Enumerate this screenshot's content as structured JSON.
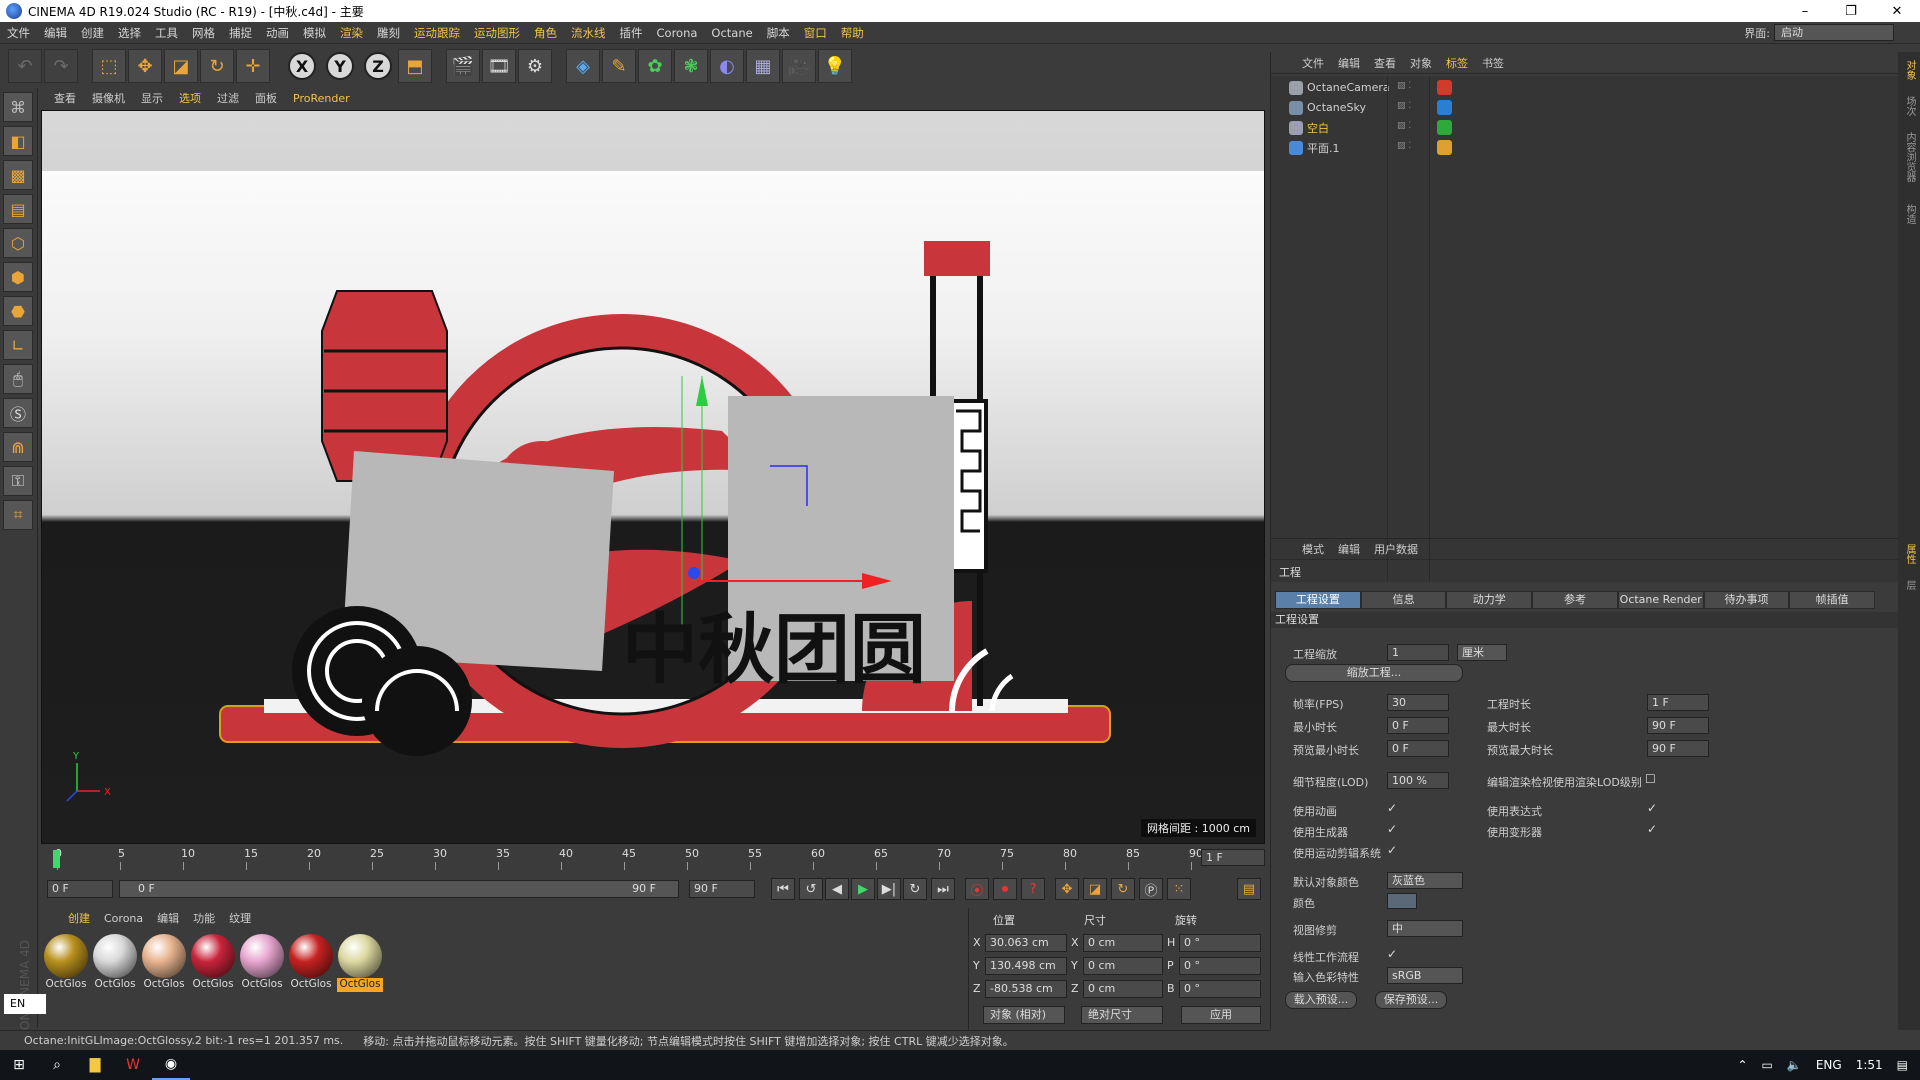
{
  "window": {
    "title": "CINEMA 4D R19.024 Studio (RC - R19) - [中秋.c4d] - 主要",
    "controls": [
      "–",
      "❐",
      "✕"
    ]
  },
  "menubar": {
    "items": [
      "文件",
      "编辑",
      "创建",
      "选择",
      "工具",
      "网格",
      "捕捉",
      "动画",
      "模拟",
      "渲染",
      "雕刻",
      "运动跟踪",
      "运动图形",
      "角色",
      "流水线",
      "插件",
      "Corona",
      "Octane",
      "脚本",
      "窗口",
      "帮助"
    ],
    "layout_label": "界面:",
    "layout_value": "启动"
  },
  "toolbar": {
    "axis_x": "X",
    "axis_y": "Y",
    "axis_z": "Z"
  },
  "viewport": {
    "menu": [
      "查看",
      "摄像机",
      "显示",
      "选项",
      "过滤",
      "面板",
      "ProRender"
    ],
    "grid_spacing": "网格间距 : 1000 cm",
    "scene_text": "中秋团圆",
    "axis_labels": {
      "y": "Y",
      "x": "X"
    }
  },
  "timeline": {
    "ticks": [
      "0",
      "5",
      "10",
      "15",
      "20",
      "25",
      "30",
      "35",
      "40",
      "45",
      "50",
      "55",
      "60",
      "65",
      "70",
      "75",
      "80",
      "85",
      "90"
    ],
    "current_frame": "1 F",
    "start_field": "0 F",
    "range_start": "0 F",
    "range_end": "90 F",
    "end_field": "90 F"
  },
  "materials": {
    "menu": [
      "创建",
      "Corona",
      "编辑",
      "功能",
      "纹理"
    ],
    "items": [
      {
        "label": "OctGlos",
        "color": "#b8901e"
      },
      {
        "label": "OctGlos",
        "color": "#d9d9d9"
      },
      {
        "label": "OctGlos",
        "color": "#e7b38e"
      },
      {
        "label": "OctGlos",
        "color": "#c8243a"
      },
      {
        "label": "OctGlos",
        "color": "#e7a6cf"
      },
      {
        "label": "OctGlos",
        "color": "#c62222"
      },
      {
        "label": "OctGlos",
        "color": "#dcd8a0",
        "selected": true
      }
    ]
  },
  "coords": {
    "headers": {
      "pos": "位置",
      "size": "尺寸",
      "rot": "旋转"
    },
    "rows": [
      {
        "axis": "X",
        "pos": "30.063 cm",
        "saxis": "X",
        "size": "0 cm",
        "raxis": "H",
        "rot": "0 °"
      },
      {
        "axis": "Y",
        "pos": "130.498 cm",
        "saxis": "Y",
        "size": "0 cm",
        "raxis": "P",
        "rot": "0 °"
      },
      {
        "axis": "Z",
        "pos": "-80.538 cm",
        "saxis": "Z",
        "size": "0 cm",
        "raxis": "B",
        "rot": "0 °"
      }
    ],
    "mode": "对象 (相对)",
    "size_mode": "绝对尺寸",
    "apply": "应用"
  },
  "statusbar": {
    "left": "Octane:InitGLImage:OctGlossy.2  bit:-1 res=1  201.357 ms.",
    "right": "移动: 点击并拖动鼠标移动元素。按住 SHIFT 键量化移动; 节点编辑模式时按住 SHIFT 键增加选择对象; 按住 CTRL 键减少选择对象。",
    "ime": "EN",
    "watermark": "MAXON CINEMA 4D"
  },
  "object_manager": {
    "menu": [
      "文件",
      "编辑",
      "查看",
      "对象",
      "标签",
      "书签"
    ],
    "objects": [
      {
        "name": "OctaneCamera",
        "color": "#9aa0a8",
        "tag": "#d23a2a"
      },
      {
        "name": "OctaneSky",
        "color": "#7a8ea8",
        "tag": "#2a7fd2"
      },
      {
        "name": "空白",
        "color": "#9aa0a8",
        "tag": "#2eaa3a",
        "highlight": true
      },
      {
        "name": "平面.1",
        "color": "#4a8ad8",
        "tag": "#e0a030"
      }
    ]
  },
  "attribute_manager": {
    "menu": [
      "模式",
      "编辑",
      "用户数据"
    ],
    "title": "工程",
    "tabs": [
      "工程设置",
      "信息",
      "动力学",
      "参考",
      "Octane Render",
      "待办事项",
      "帧插值"
    ],
    "section": "工程设置",
    "scale_label": "工程缩放",
    "scale_value": "1",
    "scale_unit": "厘米",
    "scale_button": "缩放工程...",
    "fps_label": "帧率(FPS)",
    "fps_value": "30",
    "proj_len_label": "工程时长",
    "proj_len_value": "1 F",
    "min_time_label": "最小时长",
    "min_time_value": "0 F",
    "max_time_label": "最大时长",
    "max_time_value": "90 F",
    "prev_min_label": "预览最小时长",
    "prev_min_value": "0 F",
    "prev_max_label": "预览最大时长",
    "prev_max_value": "90 F",
    "lod_label": "细节程度(LOD)",
    "lod_value": "100 %",
    "lod_render_label": "编辑渲染检视使用渲染LOD级别",
    "use_anim": "使用动画",
    "use_expr": "使用表达式",
    "use_gen": "使用生成器",
    "use_deform": "使用变形器",
    "use_motion": "使用运动剪辑系统",
    "def_color_label": "默认对象颜色",
    "def_color_value": "灰蓝色",
    "color_label": "颜色",
    "view_clip_label": "视图修剪",
    "view_clip_value": "中",
    "linear_label": "线性工作流程",
    "input_color_label": "输入色彩特性",
    "input_color_value": "sRGB",
    "load_preset": "载入预设...",
    "save_preset": "保存预设..."
  },
  "side_tabs": [
    "对象",
    "场次",
    "内容浏览器",
    "构造",
    "属性",
    "层"
  ],
  "taskbar": {
    "lang": "ENG",
    "time": "1:51"
  },
  "colors": {
    "accent": "#f3c34a",
    "tab_active": "#5a7fa8",
    "scene_red": "#c8363c",
    "scene_floor": "#1e1e1e"
  }
}
